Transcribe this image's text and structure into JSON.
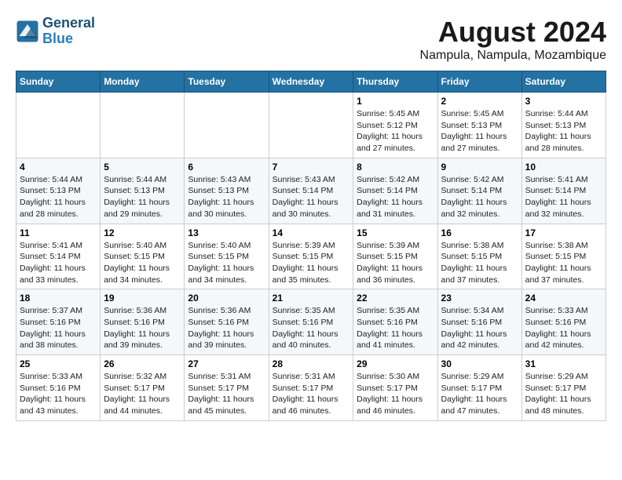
{
  "header": {
    "logo_line1": "General",
    "logo_line2": "Blue",
    "month": "August 2024",
    "location": "Nampula, Nampula, Mozambique"
  },
  "days_of_week": [
    "Sunday",
    "Monday",
    "Tuesday",
    "Wednesday",
    "Thursday",
    "Friday",
    "Saturday"
  ],
  "weeks": [
    [
      {
        "day": "",
        "info": ""
      },
      {
        "day": "",
        "info": ""
      },
      {
        "day": "",
        "info": ""
      },
      {
        "day": "",
        "info": ""
      },
      {
        "day": "1",
        "info": "Sunrise: 5:45 AM\nSunset: 5:12 PM\nDaylight: 11 hours and 27 minutes."
      },
      {
        "day": "2",
        "info": "Sunrise: 5:45 AM\nSunset: 5:13 PM\nDaylight: 11 hours and 27 minutes."
      },
      {
        "day": "3",
        "info": "Sunrise: 5:44 AM\nSunset: 5:13 PM\nDaylight: 11 hours and 28 minutes."
      }
    ],
    [
      {
        "day": "4",
        "info": "Sunrise: 5:44 AM\nSunset: 5:13 PM\nDaylight: 11 hours and 28 minutes."
      },
      {
        "day": "5",
        "info": "Sunrise: 5:44 AM\nSunset: 5:13 PM\nDaylight: 11 hours and 29 minutes."
      },
      {
        "day": "6",
        "info": "Sunrise: 5:43 AM\nSunset: 5:13 PM\nDaylight: 11 hours and 30 minutes."
      },
      {
        "day": "7",
        "info": "Sunrise: 5:43 AM\nSunset: 5:14 PM\nDaylight: 11 hours and 30 minutes."
      },
      {
        "day": "8",
        "info": "Sunrise: 5:42 AM\nSunset: 5:14 PM\nDaylight: 11 hours and 31 minutes."
      },
      {
        "day": "9",
        "info": "Sunrise: 5:42 AM\nSunset: 5:14 PM\nDaylight: 11 hours and 32 minutes."
      },
      {
        "day": "10",
        "info": "Sunrise: 5:41 AM\nSunset: 5:14 PM\nDaylight: 11 hours and 32 minutes."
      }
    ],
    [
      {
        "day": "11",
        "info": "Sunrise: 5:41 AM\nSunset: 5:14 PM\nDaylight: 11 hours and 33 minutes."
      },
      {
        "day": "12",
        "info": "Sunrise: 5:40 AM\nSunset: 5:15 PM\nDaylight: 11 hours and 34 minutes."
      },
      {
        "day": "13",
        "info": "Sunrise: 5:40 AM\nSunset: 5:15 PM\nDaylight: 11 hours and 34 minutes."
      },
      {
        "day": "14",
        "info": "Sunrise: 5:39 AM\nSunset: 5:15 PM\nDaylight: 11 hours and 35 minutes."
      },
      {
        "day": "15",
        "info": "Sunrise: 5:39 AM\nSunset: 5:15 PM\nDaylight: 11 hours and 36 minutes."
      },
      {
        "day": "16",
        "info": "Sunrise: 5:38 AM\nSunset: 5:15 PM\nDaylight: 11 hours and 37 minutes."
      },
      {
        "day": "17",
        "info": "Sunrise: 5:38 AM\nSunset: 5:15 PM\nDaylight: 11 hours and 37 minutes."
      }
    ],
    [
      {
        "day": "18",
        "info": "Sunrise: 5:37 AM\nSunset: 5:16 PM\nDaylight: 11 hours and 38 minutes."
      },
      {
        "day": "19",
        "info": "Sunrise: 5:36 AM\nSunset: 5:16 PM\nDaylight: 11 hours and 39 minutes."
      },
      {
        "day": "20",
        "info": "Sunrise: 5:36 AM\nSunset: 5:16 PM\nDaylight: 11 hours and 39 minutes."
      },
      {
        "day": "21",
        "info": "Sunrise: 5:35 AM\nSunset: 5:16 PM\nDaylight: 11 hours and 40 minutes."
      },
      {
        "day": "22",
        "info": "Sunrise: 5:35 AM\nSunset: 5:16 PM\nDaylight: 11 hours and 41 minutes."
      },
      {
        "day": "23",
        "info": "Sunrise: 5:34 AM\nSunset: 5:16 PM\nDaylight: 11 hours and 42 minutes."
      },
      {
        "day": "24",
        "info": "Sunrise: 5:33 AM\nSunset: 5:16 PM\nDaylight: 11 hours and 42 minutes."
      }
    ],
    [
      {
        "day": "25",
        "info": "Sunrise: 5:33 AM\nSunset: 5:16 PM\nDaylight: 11 hours and 43 minutes."
      },
      {
        "day": "26",
        "info": "Sunrise: 5:32 AM\nSunset: 5:17 PM\nDaylight: 11 hours and 44 minutes."
      },
      {
        "day": "27",
        "info": "Sunrise: 5:31 AM\nSunset: 5:17 PM\nDaylight: 11 hours and 45 minutes."
      },
      {
        "day": "28",
        "info": "Sunrise: 5:31 AM\nSunset: 5:17 PM\nDaylight: 11 hours and 46 minutes."
      },
      {
        "day": "29",
        "info": "Sunrise: 5:30 AM\nSunset: 5:17 PM\nDaylight: 11 hours and 46 minutes."
      },
      {
        "day": "30",
        "info": "Sunrise: 5:29 AM\nSunset: 5:17 PM\nDaylight: 11 hours and 47 minutes."
      },
      {
        "day": "31",
        "info": "Sunrise: 5:29 AM\nSunset: 5:17 PM\nDaylight: 11 hours and 48 minutes."
      }
    ]
  ]
}
